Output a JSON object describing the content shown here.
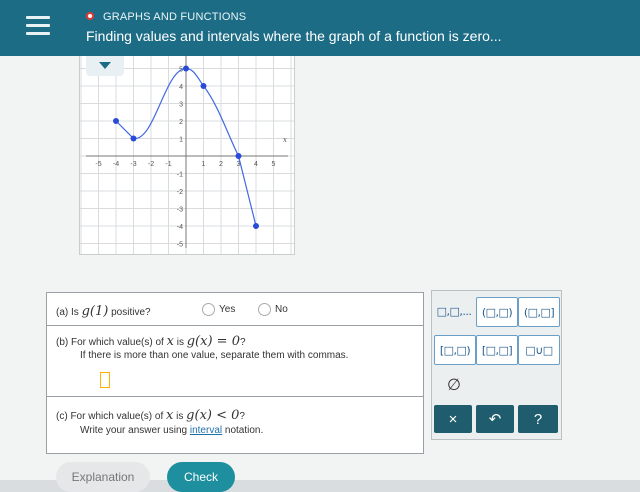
{
  "header": {
    "topic": "GRAPHS AND FUNCTIONS",
    "title": "Finding values and intervals where the graph of a function is zero..."
  },
  "graph": {
    "x_ticks": [
      "-5",
      "-4",
      "-3",
      "-2",
      "-1",
      "1",
      "2",
      "3",
      "4",
      "5"
    ],
    "y_ticks": [
      "5",
      "4",
      "3",
      "2",
      "1",
      "-1",
      "-2",
      "-3",
      "-4",
      "-5"
    ],
    "x_axis_label": "x",
    "points": [
      [
        -4,
        2
      ],
      [
        -3,
        1
      ],
      [
        0,
        5
      ],
      [
        1,
        4
      ],
      [
        3,
        0
      ],
      [
        4,
        -4
      ]
    ],
    "line_color": "#4169e1"
  },
  "questions": {
    "a": {
      "prefix": "(a) Is",
      "expr": "g(1)",
      "suffix": "positive?",
      "yes": "Yes",
      "no": "No"
    },
    "b": {
      "line1_prefix": "(b) For which value(s) of",
      "var": "x",
      "line1_mid": "is",
      "expr": "g(x) = 0",
      "q": "?",
      "line2": "If there is more than one value, separate them with commas."
    },
    "c": {
      "line1_prefix": "(c) For which value(s) of",
      "var": "x",
      "line1_mid": "is",
      "expr": "g(x) < 0",
      "q": "?",
      "line2_prefix": "Write your answer using",
      "link": "interval",
      "line2_suffix": "notation."
    }
  },
  "keyboard": {
    "list": "□,□,...",
    "open_open": "(□,□)",
    "open_closed": "(□,□]",
    "closed_closed": "[□,□]",
    "closed_open": "[□,□)",
    "union": "□∪□",
    "empty": "∅",
    "clear": "×",
    "undo": "↶",
    "help": "?"
  },
  "buttons": {
    "explanation": "Explanation",
    "check": "Check"
  }
}
